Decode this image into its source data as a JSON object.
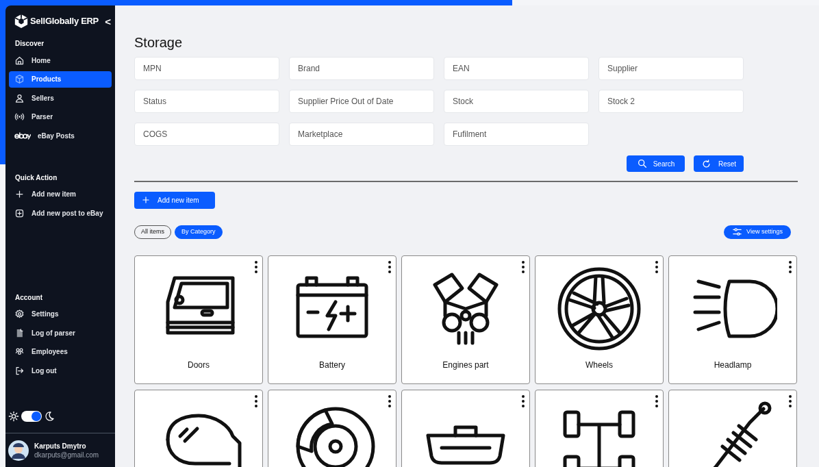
{
  "sidebar": {
    "brand": "SellGlobally ERP",
    "collapse": "<",
    "sections": [
      {
        "title": "Discover",
        "items": [
          {
            "label": "Home",
            "selected": false
          },
          {
            "label": "Products",
            "selected": true
          },
          {
            "label": "Sellers",
            "selected": false
          },
          {
            "label": "Parser",
            "selected": false
          },
          {
            "label": "eBay Posts",
            "selected": false
          }
        ]
      },
      {
        "title": "Quick Action",
        "items": [
          {
            "label": "Add new item",
            "selected": false
          },
          {
            "label": "Add new post to eBay",
            "selected": false
          }
        ]
      },
      {
        "title": "Account",
        "items": [
          {
            "label": "Settings",
            "selected": false
          },
          {
            "label": "Log of parser",
            "selected": false
          },
          {
            "label": "Employees",
            "selected": false
          },
          {
            "label": "Log out",
            "selected": false
          }
        ]
      }
    ],
    "theme_toggle": {
      "on": true
    },
    "user": {
      "name": "Karputs Dmytro",
      "email": "dkarputs@gmail.com"
    }
  },
  "page": {
    "title": "Storage",
    "filters": [
      {
        "placeholder": "MPN"
      },
      {
        "placeholder": "Brand"
      },
      {
        "placeholder": "EAN"
      },
      {
        "placeholder": "Supplier"
      },
      {
        "placeholder": "Status"
      },
      {
        "placeholder": "Supplier Price Out of Date"
      },
      {
        "placeholder": "Stock"
      },
      {
        "placeholder": "Stock 2"
      },
      {
        "placeholder": "COGS"
      },
      {
        "placeholder": "Marketplace"
      },
      {
        "placeholder": "Fufilment"
      }
    ],
    "search_button": "Search",
    "reset_button": "Reset",
    "add_button": "Add new item",
    "view_tabs": [
      {
        "label": "All items",
        "selected": false
      },
      {
        "label": "By Category",
        "selected": true
      }
    ],
    "view_settings": "View settings",
    "categories": [
      {
        "label": "Doors"
      },
      {
        "label": "Battery"
      },
      {
        "label": "Engines part"
      },
      {
        "label": "Wheels"
      },
      {
        "label": "Headlamp"
      }
    ]
  }
}
